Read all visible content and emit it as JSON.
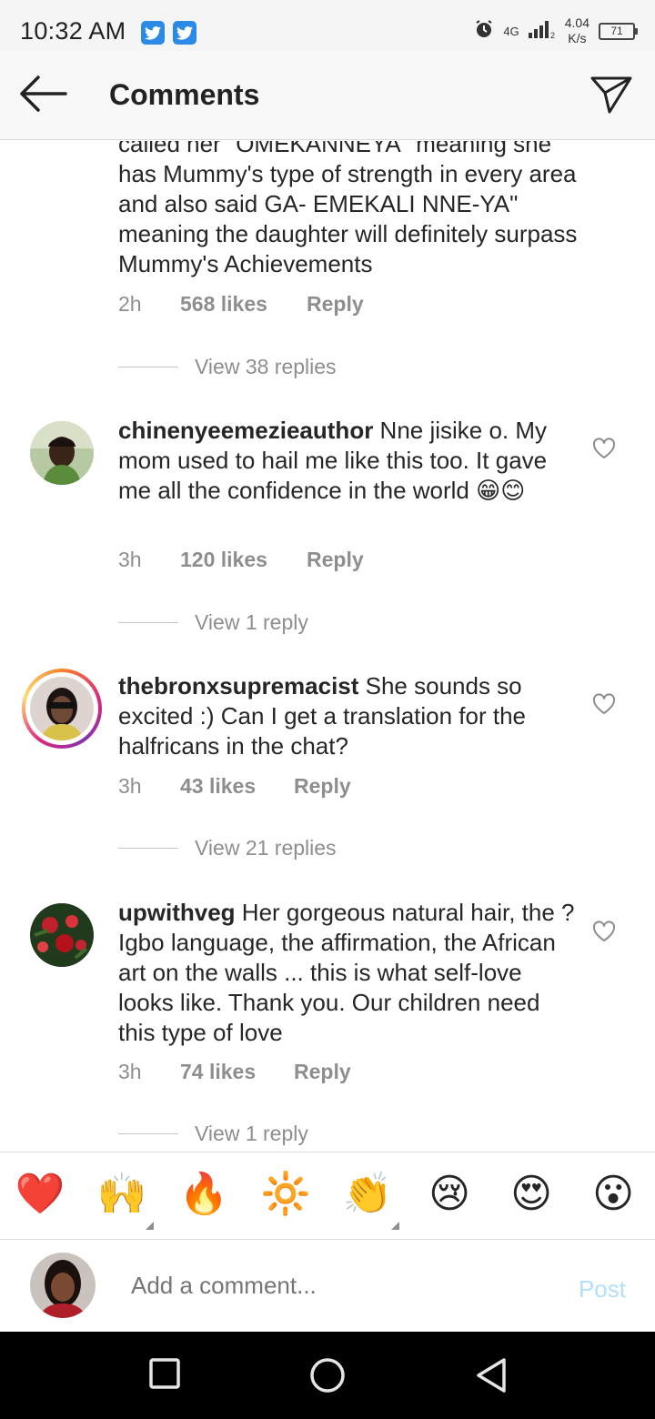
{
  "status_bar": {
    "time": "10:32 AM",
    "network": "4G",
    "speed_value": "4.04",
    "speed_unit": "K/s",
    "battery": "71"
  },
  "header": {
    "title": "Comments"
  },
  "comments": [
    {
      "username": "",
      "text": "called her \"OMEKANNEYA\" meaning she has Mummy's type of strength in every area  and also said GA- EMEKALI NNE-YA\" meaning the daughter will definitely surpass Mummy's Achievements",
      "time": "2h",
      "likes": "568 likes",
      "reply": "Reply",
      "view_replies": "View 38 replies"
    },
    {
      "username": "chinenyeemezieauthor",
      "text": " Nne jisike o. My mom used to hail me like this too. It gave me all the confidence in the world 😁😊",
      "time": "3h",
      "likes": "120 likes",
      "reply": "Reply",
      "view_replies": "View 1 reply"
    },
    {
      "username": "thebronxsupremacist",
      "text": " She sounds so excited :) Can I get a translation for the halfricans in the chat?",
      "time": "3h",
      "likes": "43 likes",
      "reply": "Reply",
      "view_replies": "View 21 replies"
    },
    {
      "username": "upwithveg",
      "text": " Her gorgeous natural hair, the ?Igbo language, the affirmation, the African art on the walls ... this is what self-love looks like. Thank you. Our children need this type of love",
      "time": "3h",
      "likes": "74 likes",
      "reply": "Reply",
      "view_replies": "View 1 reply"
    }
  ],
  "emoji_bar": [
    "❤️",
    "🙌",
    "🔥",
    "🔆",
    "👏",
    "😢",
    "😍",
    "😮"
  ],
  "composer": {
    "placeholder": "Add a comment...",
    "post_label": "Post"
  },
  "colors": {
    "accent_link": "#b2dffc",
    "meta_gray": "#8e8e8e",
    "twitter_blue": "#2a8ae6"
  }
}
